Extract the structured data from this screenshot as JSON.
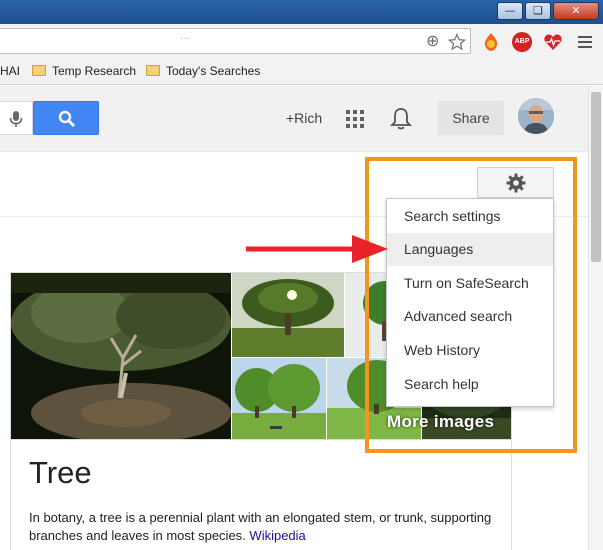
{
  "window": {
    "controls": [
      "minimize",
      "restore",
      "close"
    ]
  },
  "toolbar": {
    "url_text": "…",
    "icons": [
      "zoom-icon",
      "bookmark-star-icon",
      "honey-extension-icon",
      "adblock-plus-icon",
      "heartbeat-extension-icon",
      "chrome-menu-icon"
    ],
    "adblock_label": "ABP"
  },
  "bookmarks": {
    "items": [
      {
        "label": "HAI"
      },
      {
        "label": "Temp Research"
      },
      {
        "label": "Today's Searches"
      }
    ]
  },
  "header": {
    "user_link": "+Rich",
    "share_label": "Share"
  },
  "menu": {
    "items": [
      {
        "label": "Search settings"
      },
      {
        "label": "Languages"
      },
      {
        "label": "Turn on SafeSearch"
      },
      {
        "label": "Advanced search"
      },
      {
        "label": "Web History"
      },
      {
        "label": "Search help"
      }
    ],
    "highlighted_item": "Languages"
  },
  "images": {
    "more_label": "More images"
  },
  "card": {
    "title": "Tree",
    "description": "In botany, a tree is a perennial plant with an elongated stem, or trunk, supporting branches and leaves in most species.",
    "source_link": "Wikipedia"
  },
  "colors": {
    "annotation_box": "#f7941d",
    "annotation_arrow": "#e8232a",
    "search_blue": "#4285f4",
    "link_blue": "#1a0dab",
    "titlebar_blue": "#2a63a8"
  }
}
